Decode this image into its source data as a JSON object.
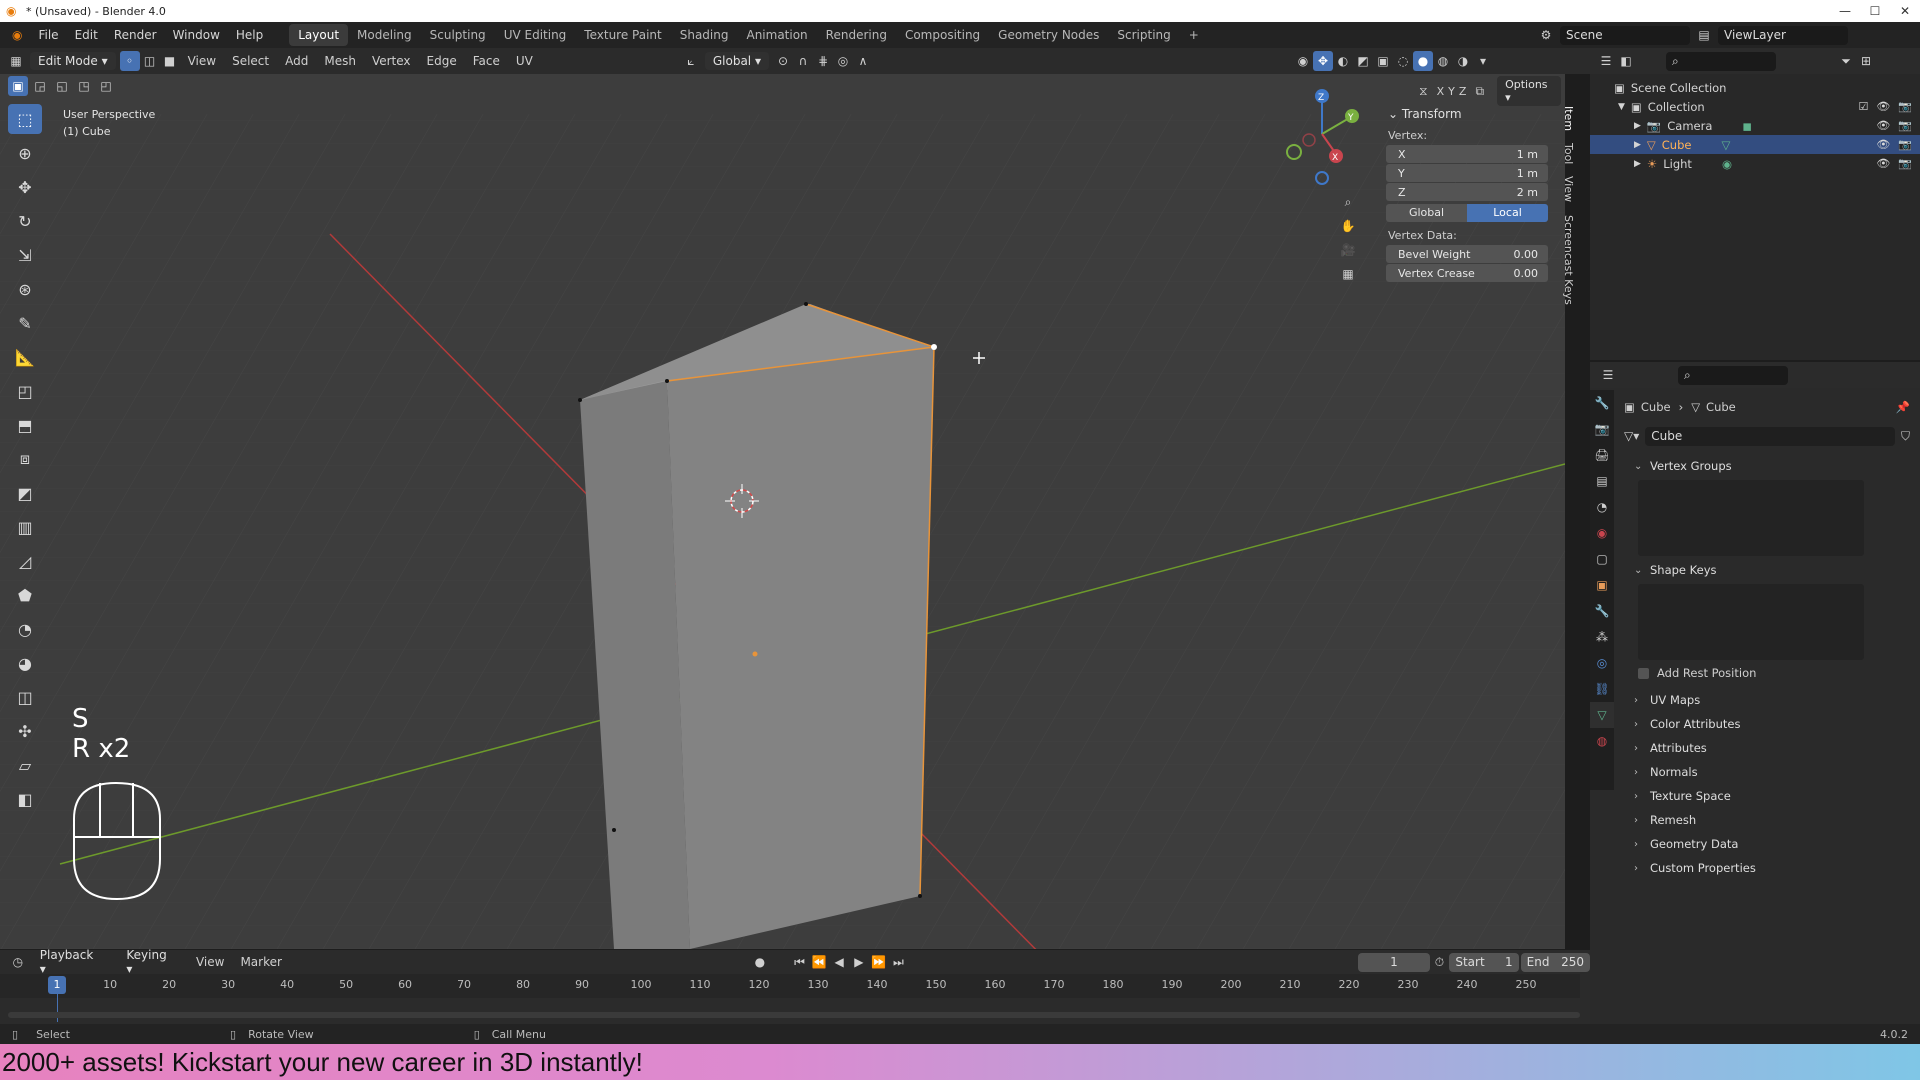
{
  "window": {
    "title": "* (Unsaved) - Blender 4.0",
    "controls": [
      "—",
      "☐",
      "✕"
    ]
  },
  "menu": [
    "File",
    "Edit",
    "Render",
    "Window",
    "Help"
  ],
  "workspaces": [
    "Layout",
    "Modeling",
    "Sculpting",
    "UV Editing",
    "Texture Paint",
    "Shading",
    "Animation",
    "Rendering",
    "Compositing",
    "Geometry Nodes",
    "Scripting",
    "+"
  ],
  "active_workspace": "Layout",
  "scene": {
    "scene_name": "Scene",
    "view_layer": "ViewLayer"
  },
  "view3d_header": {
    "mode": "Edit Mode",
    "menus": [
      "View",
      "Select",
      "Add",
      "Mesh",
      "Vertex",
      "Edge",
      "Face",
      "UV"
    ],
    "orientation": "Global",
    "options_label": "Options",
    "axes": [
      "X",
      "Y",
      "Z"
    ]
  },
  "viewport": {
    "view_name": "User Perspective",
    "object_name": "(1) Cube",
    "keys_line1": "S",
    "keys_line2": "R x2",
    "gizmo": {
      "x": "X",
      "y": "Y",
      "z": "Z"
    }
  },
  "n_panel": {
    "section": "Transform",
    "vertex_label": "Vertex:",
    "fields": [
      {
        "label": "X",
        "value": "1 m"
      },
      {
        "label": "Y",
        "value": "1 m"
      },
      {
        "label": "Z",
        "value": "2 m"
      }
    ],
    "space_global": "Global",
    "space_local": "Local",
    "vertex_data_label": "Vertex Data:",
    "bevel_weight": {
      "label": "Bevel Weight",
      "value": "0.00"
    },
    "vertex_crease": {
      "label": "Vertex Crease",
      "value": "0.00"
    },
    "tabs": [
      "Item",
      "Tool",
      "View",
      "Screencast Keys"
    ]
  },
  "outliner": {
    "root": "Scene Collection",
    "collection": "Collection",
    "items": [
      "Camera",
      "Cube",
      "Light"
    ]
  },
  "properties": {
    "breadcrumb_object": "Cube",
    "breadcrumb_mesh": "Cube",
    "mesh_name": "Cube",
    "panels_open": [
      "Vertex Groups",
      "Shape Keys"
    ],
    "add_rest_position": "Add Rest Position",
    "panels_closed": [
      "UV Maps",
      "Color Attributes",
      "Attributes",
      "Normals",
      "Texture Space",
      "Remesh",
      "Geometry Data",
      "Custom Properties"
    ]
  },
  "timeline": {
    "menus": [
      "Playback",
      "Keying",
      "View",
      "Marker"
    ],
    "current_frame": "1",
    "start_label": "Start",
    "start": "1",
    "end_label": "End",
    "end": "250",
    "ticks": [
      "1",
      "10",
      "20",
      "30",
      "40",
      "50",
      "60",
      "70",
      "80",
      "90",
      "100",
      "110",
      "120",
      "130",
      "140",
      "150",
      "160",
      "170",
      "180",
      "190",
      "200",
      "210",
      "220",
      "230",
      "240",
      "250"
    ]
  },
  "statusbar": {
    "select": "Select",
    "rotate": "Rotate View",
    "call_menu": "Call Menu",
    "version": "4.0.2"
  },
  "banner": {
    "text": "2000+ assets! Kickstart your new career in 3D instantly!"
  },
  "colors": {
    "accent": "#4772b3",
    "selection_orange": "#e8943a",
    "axis_red": "#b23a3a",
    "axis_green": "#6d9a2b"
  }
}
